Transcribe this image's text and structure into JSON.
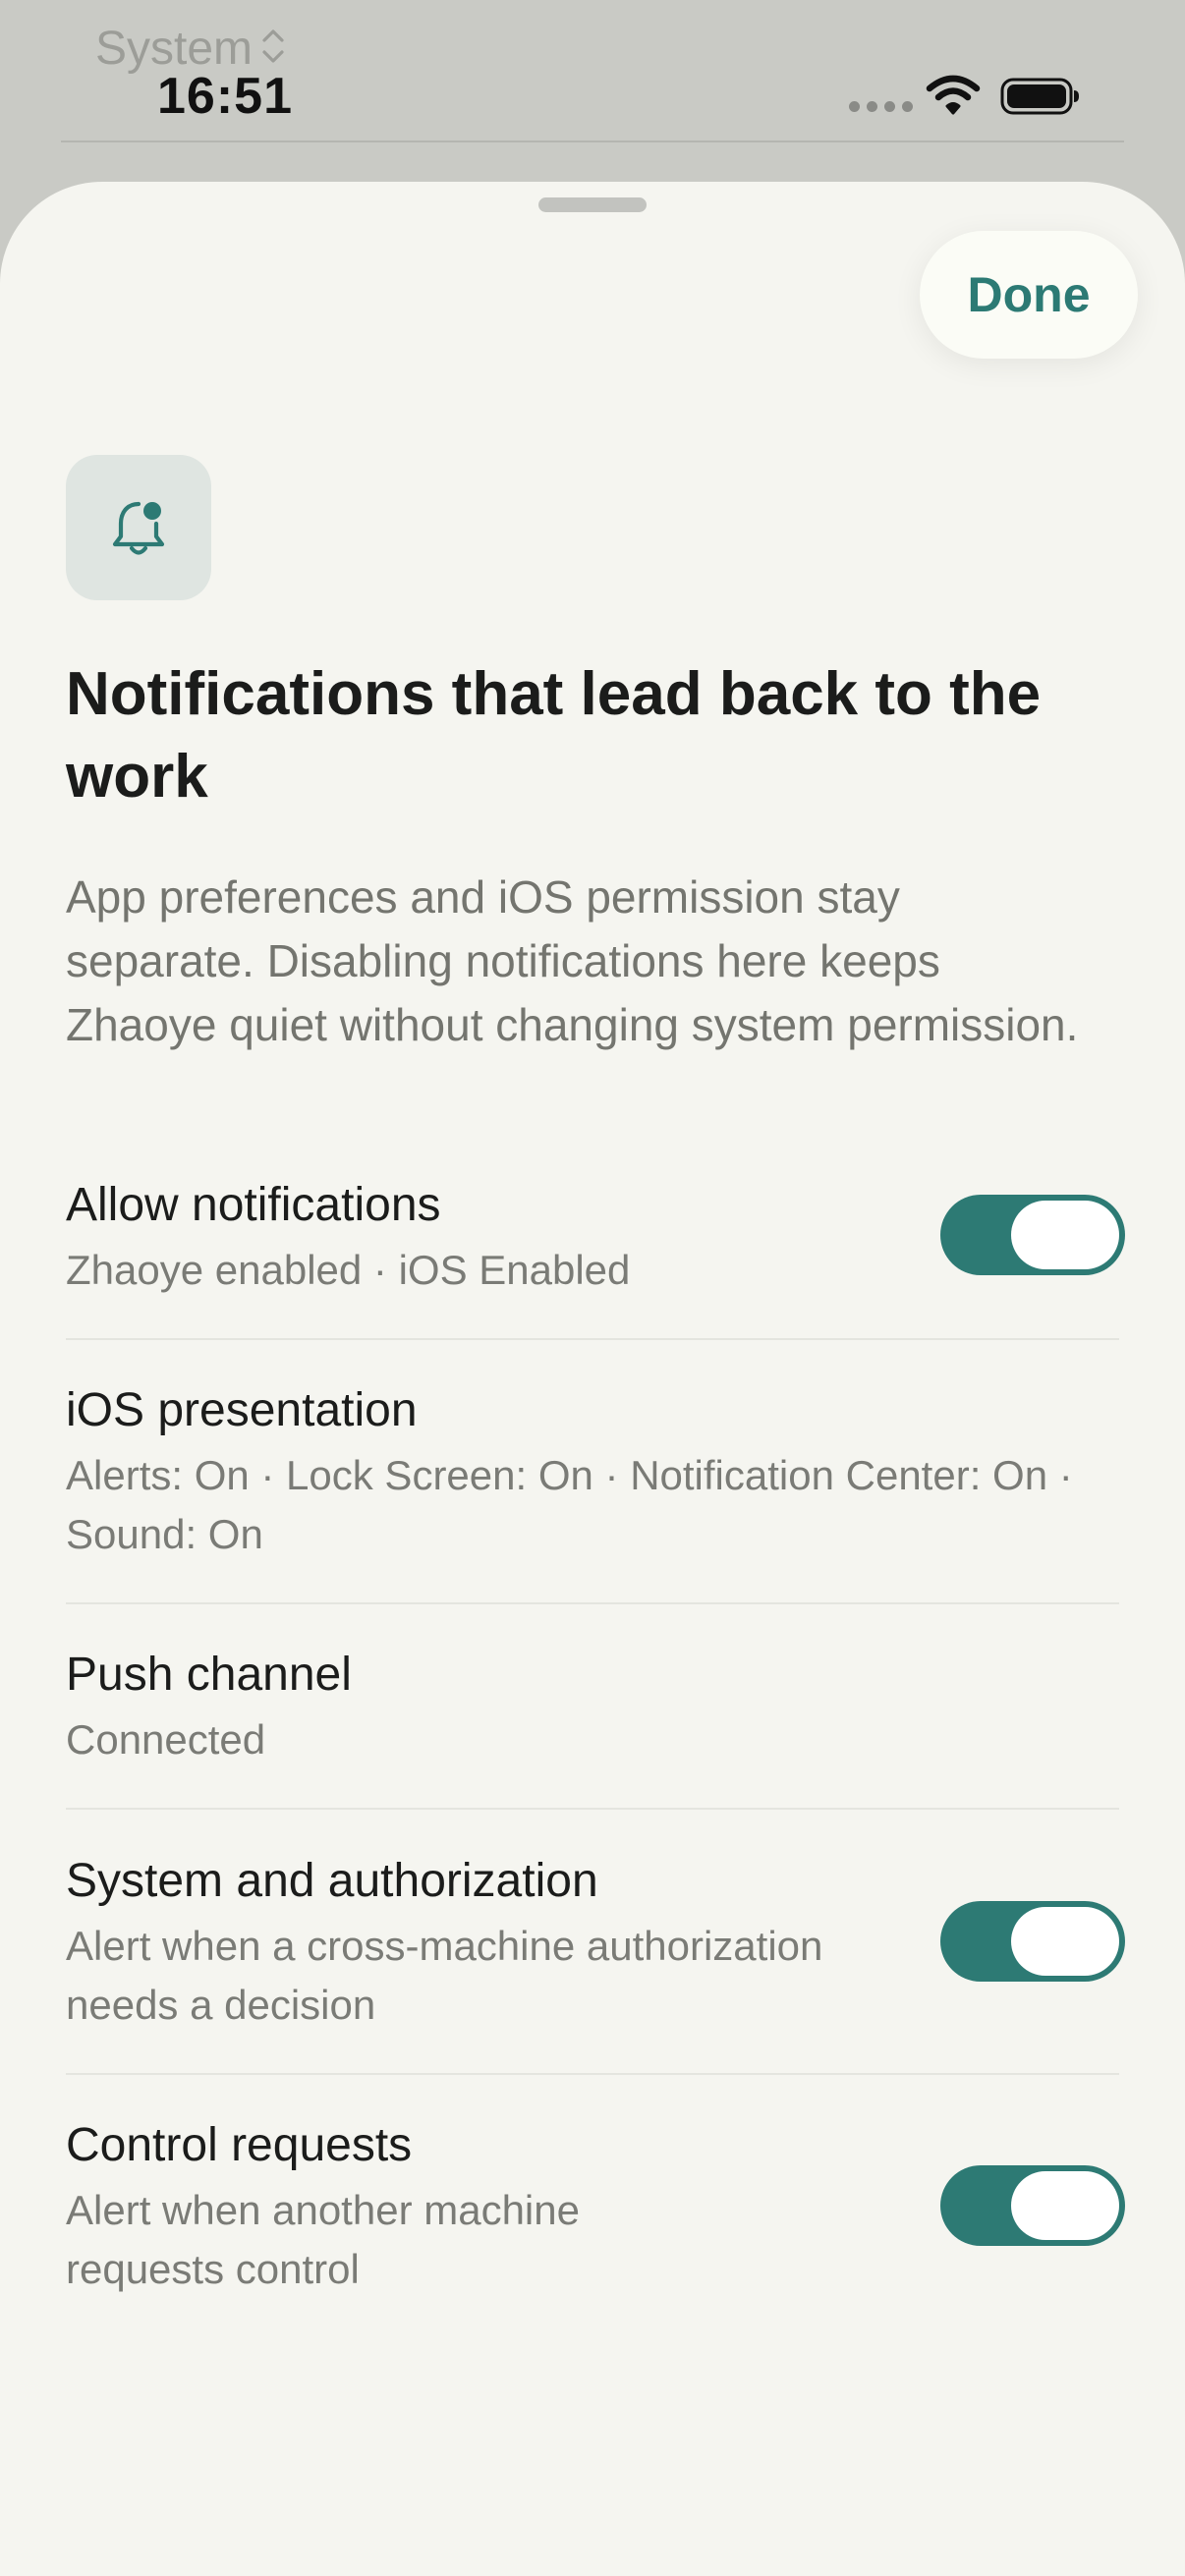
{
  "status_bar": {
    "app_switcher_label": "System",
    "time": "16:51",
    "icons": [
      "wifi-icon",
      "battery-icon"
    ]
  },
  "sheet": {
    "done_label": "Done",
    "header_icon": "bell-badge-icon",
    "title": "Notifications that lead back to the work",
    "description": "App preferences and iOS permission stay separate. Disabling notifications here keeps Zhaoye quiet without changing system permission."
  },
  "settings": {
    "allow_notifications": {
      "title": "Allow notifications",
      "subtitle": "Zhaoye enabled · iOS Enabled",
      "enabled": true
    },
    "ios_presentation": {
      "title": "iOS presentation",
      "subtitle": "Alerts: On · Lock Screen: On · Notification Center: On · Sound: On"
    },
    "push_channel": {
      "title": "Push channel",
      "subtitle": "Connected"
    },
    "system_authorization": {
      "title": "System and authorization",
      "subtitle": "Alert when a cross-machine authorization needs a decision",
      "enabled": true
    },
    "control_requests": {
      "title": "Control requests",
      "subtitle": "Alert when another machine requests control",
      "enabled": true
    }
  },
  "colors": {
    "accent": "#2d7a74",
    "sheet_background": "#f5f5f0",
    "toggle_knob": "#ffffff"
  }
}
